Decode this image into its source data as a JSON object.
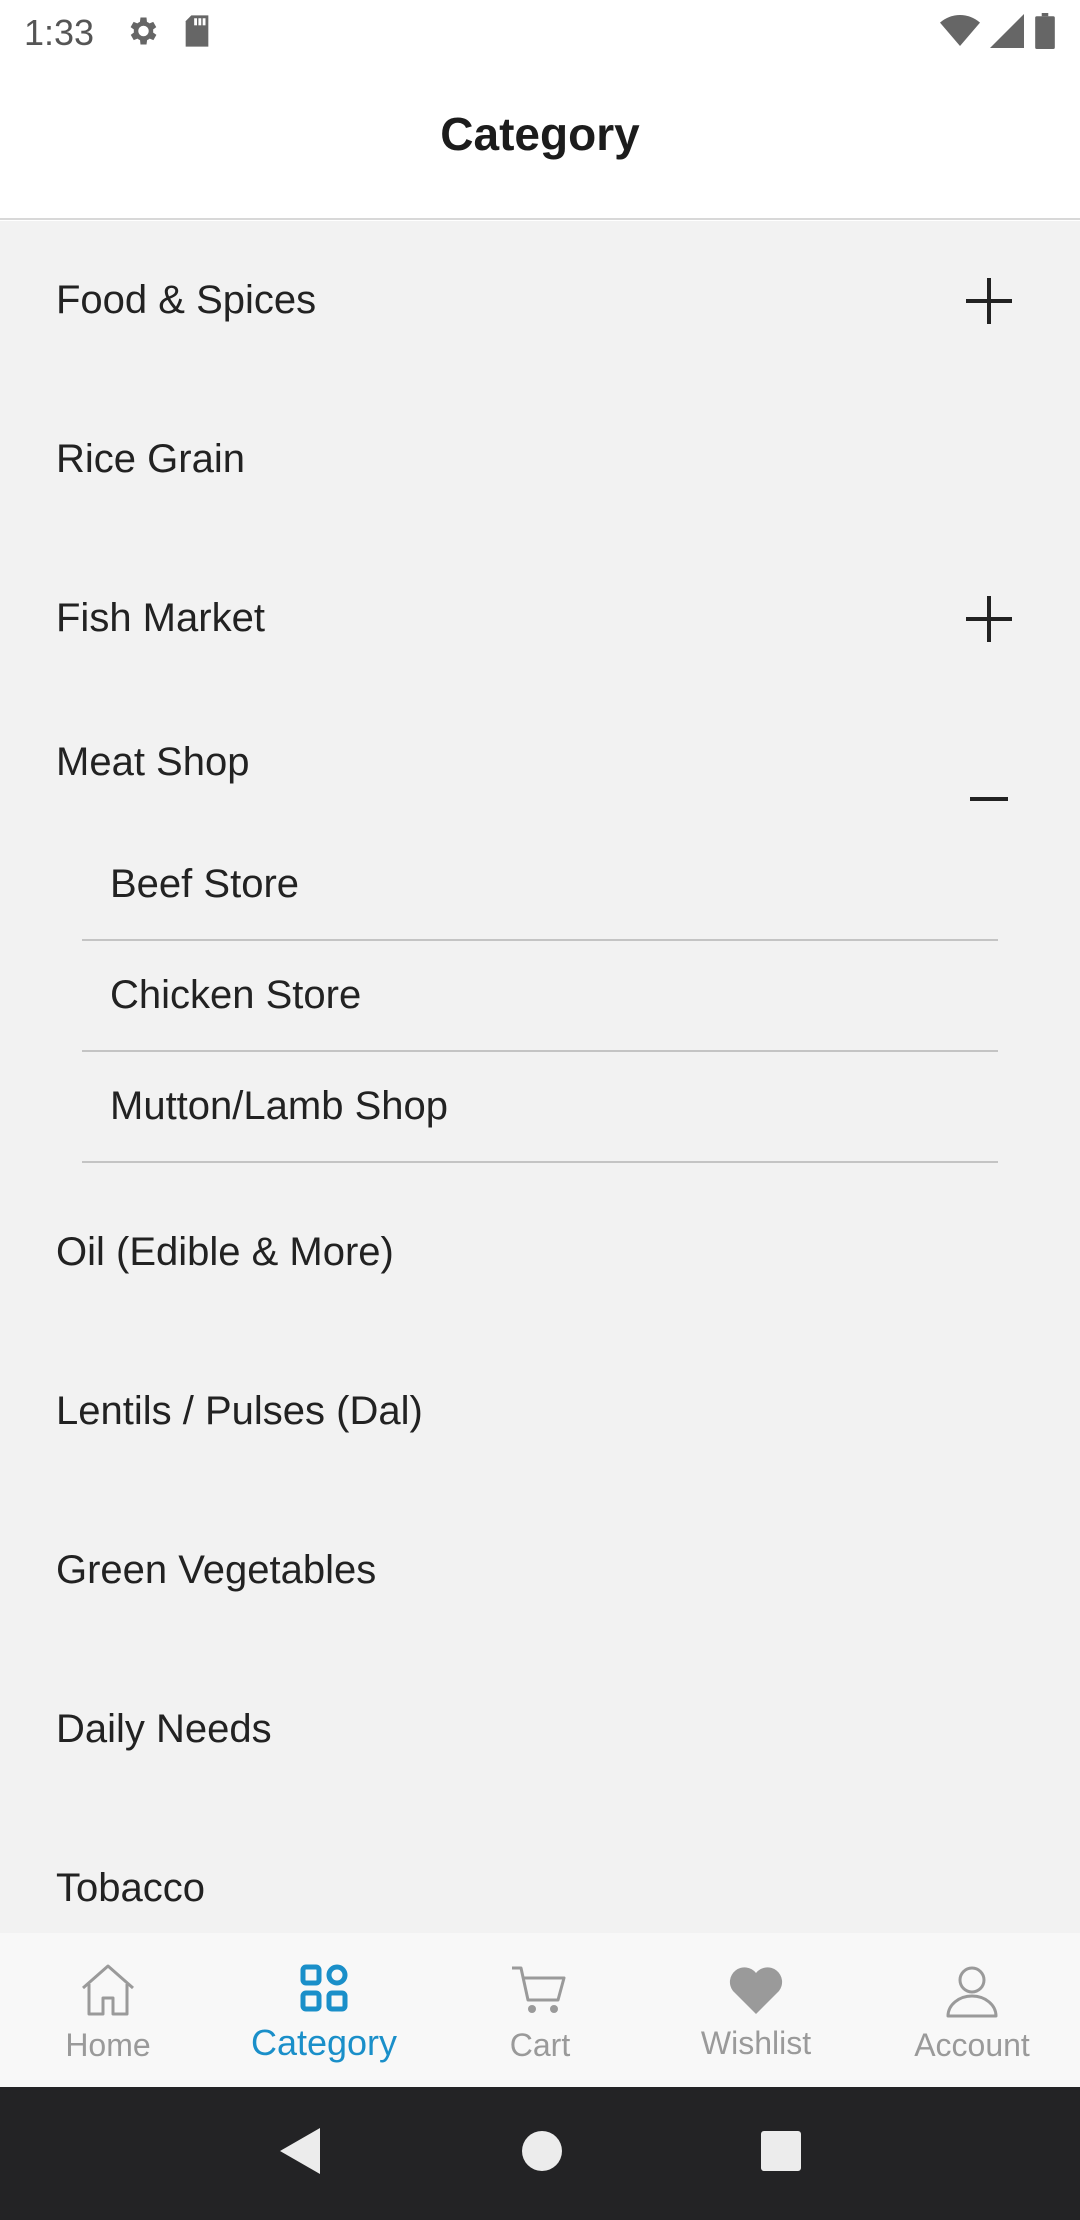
{
  "status_bar": {
    "time": "1:33",
    "icons": [
      "settings-gear-icon",
      "sd-card-icon",
      "wifi-icon",
      "cell-signal-icon",
      "battery-icon"
    ]
  },
  "header": {
    "title": "Category"
  },
  "categories": [
    {
      "label": "Food & Spices",
      "toggle": "plus"
    },
    {
      "label": "Rice Grain",
      "toggle": "none"
    },
    {
      "label": "Fish Market",
      "toggle": "plus"
    },
    {
      "label": "Meat Shop",
      "toggle": "minus",
      "children": [
        "Beef Store",
        "Chicken Store",
        "Mutton/Lamb Shop"
      ]
    },
    {
      "label": "Oil (Edible & More)",
      "toggle": "none"
    },
    {
      "label": "Lentils / Pulses (Dal)",
      "toggle": "none"
    },
    {
      "label": "Green Vegetables",
      "toggle": "none"
    },
    {
      "label": "Daily Needs",
      "toggle": "none"
    },
    {
      "label": "Tobacco",
      "toggle": "none"
    }
  ],
  "bottom_nav": {
    "items": [
      {
        "label": "Home",
        "icon": "home-icon"
      },
      {
        "label": "Category",
        "icon": "grid-icon",
        "active": true
      },
      {
        "label": "Cart",
        "icon": "cart-icon"
      },
      {
        "label": "Wishlist",
        "icon": "heart-icon"
      },
      {
        "label": "Account",
        "icon": "person-icon"
      }
    ],
    "active_color": "#1a8fc9",
    "inactive_color": "#9a9a9a"
  },
  "system_nav": {
    "icons": [
      "back-icon",
      "home-circle-icon",
      "recents-icon"
    ]
  }
}
